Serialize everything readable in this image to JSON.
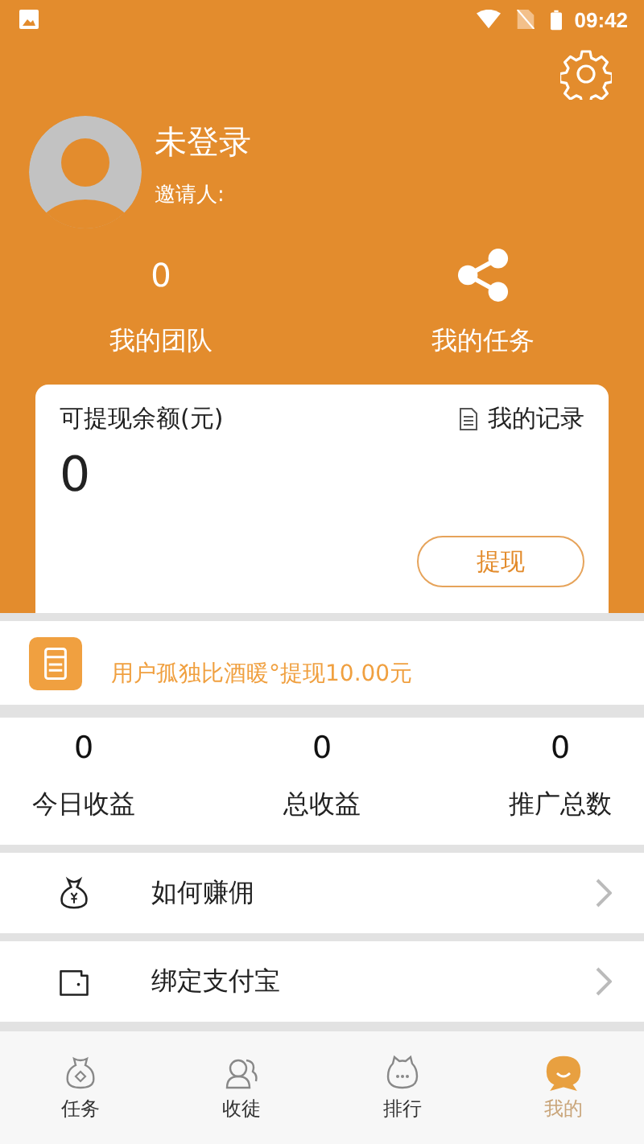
{
  "status_bar": {
    "time": "09:42"
  },
  "profile": {
    "name": "未登录",
    "inviter_label": "邀请人:"
  },
  "header_stats": [
    {
      "kind": "count",
      "value": "0",
      "label": "我的团队"
    },
    {
      "kind": "share",
      "label": "我的任务"
    }
  ],
  "balance_card": {
    "title": "可提现余额(元)",
    "records_link": "我的记录",
    "amount": "0",
    "withdraw_button": "提现"
  },
  "notice": {
    "text": "用户孤独比酒暖°提现10.00元"
  },
  "stats": [
    {
      "value": "0",
      "label": "今日收益"
    },
    {
      "value": "0",
      "label": "总收益"
    },
    {
      "value": "0",
      "label": "推广总数"
    }
  ],
  "menu": [
    {
      "kind": "money-bag",
      "label": "如何赚佣"
    },
    {
      "kind": "wallet",
      "label": "绑定支付宝"
    }
  ],
  "tab_bar": [
    {
      "kind": "task",
      "label": "任务",
      "selected": false
    },
    {
      "kind": "people",
      "label": "收徒",
      "selected": false
    },
    {
      "kind": "rank",
      "label": "排行",
      "selected": false
    },
    {
      "kind": "me",
      "label": "我的",
      "selected": true
    }
  ]
}
